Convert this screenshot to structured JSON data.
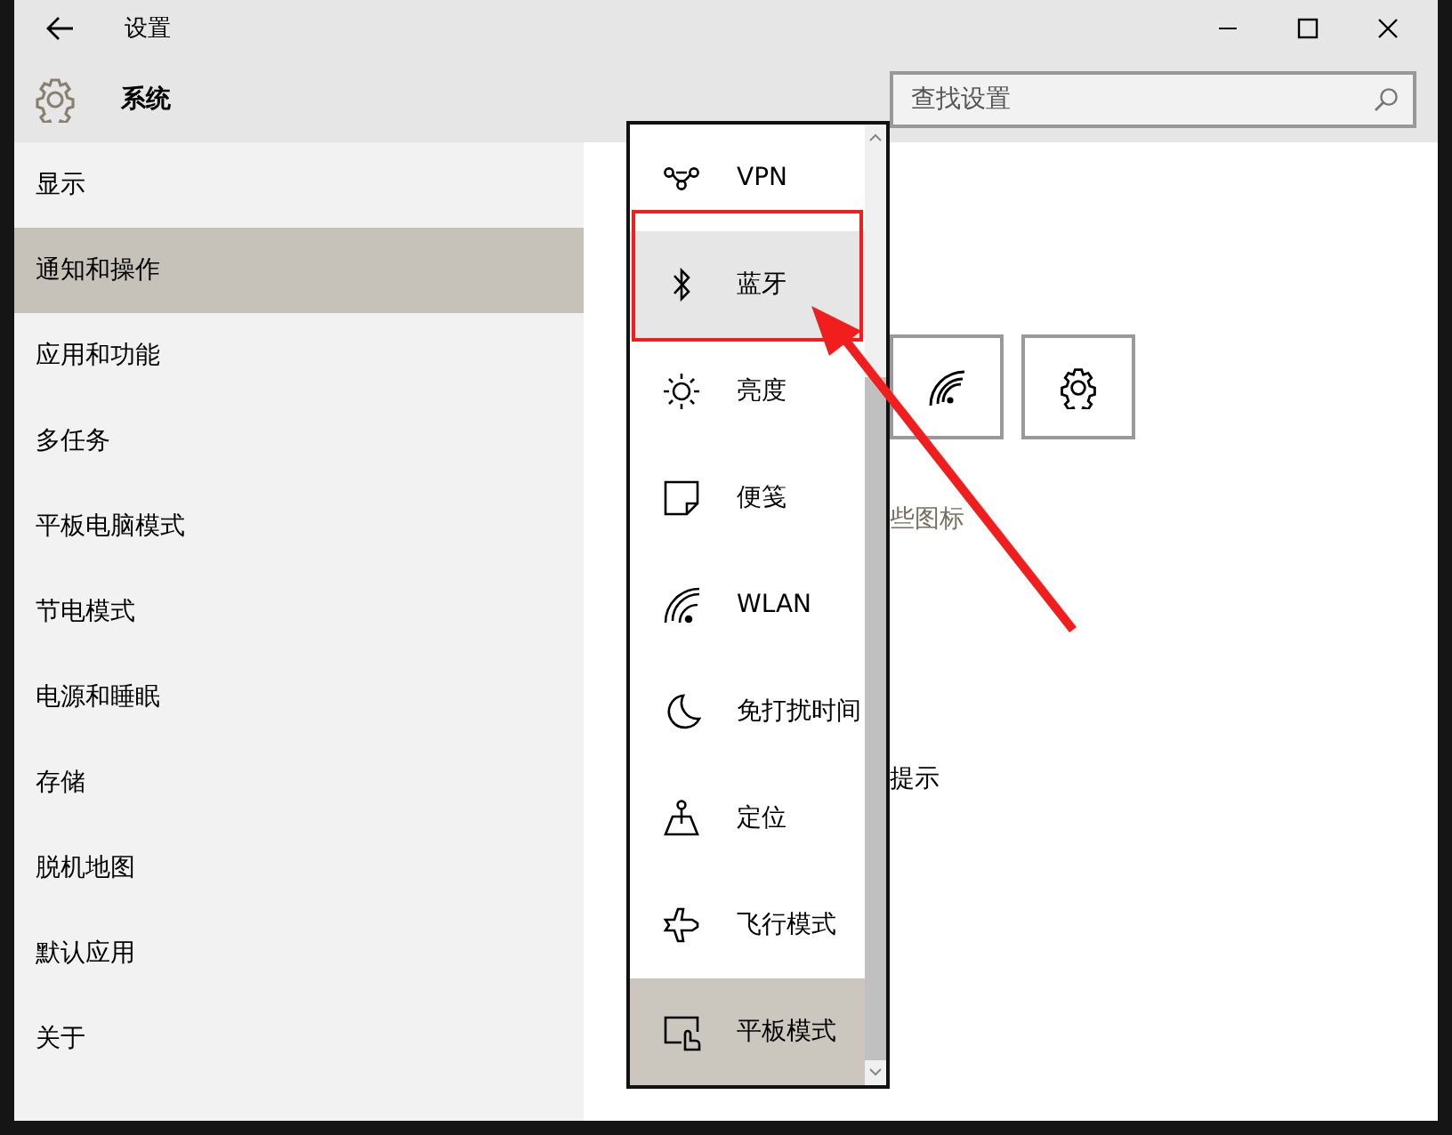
{
  "window": {
    "title": "设置"
  },
  "header": {
    "title": "系统",
    "search": {
      "placeholder": "查找设置"
    }
  },
  "sidebar": {
    "items": [
      {
        "label": "显示",
        "selected": false
      },
      {
        "label": "通知和操作",
        "selected": true
      },
      {
        "label": "应用和功能",
        "selected": false
      },
      {
        "label": "多任务",
        "selected": false
      },
      {
        "label": "平板电脑模式",
        "selected": false
      },
      {
        "label": "节电模式",
        "selected": false
      },
      {
        "label": "电源和睡眠",
        "selected": false
      },
      {
        "label": "存储",
        "selected": false
      },
      {
        "label": "脱机地图",
        "selected": false
      },
      {
        "label": "默认应用",
        "selected": false
      },
      {
        "label": "关于",
        "selected": false
      }
    ]
  },
  "main": {
    "tiles": [
      {
        "kind": "wifi"
      },
      {
        "kind": "gear"
      }
    ],
    "texts": [
      "些图标",
      "提示"
    ]
  },
  "quick_actions_menu": {
    "items": [
      {
        "kind": "vpn",
        "label": "VPN",
        "highlighted": false,
        "selected": false
      },
      {
        "kind": "bluetooth",
        "label": "蓝牙",
        "highlighted": true,
        "selected": false
      },
      {
        "kind": "brightness",
        "label": "亮度",
        "highlighted": false,
        "selected": false
      },
      {
        "kind": "note",
        "label": "便笺",
        "highlighted": false,
        "selected": false
      },
      {
        "kind": "wifi",
        "label": "WLAN",
        "highlighted": false,
        "selected": false
      },
      {
        "kind": "moon",
        "label": "免打扰时间",
        "highlighted": false,
        "selected": false
      },
      {
        "kind": "location",
        "label": "定位",
        "highlighted": false,
        "selected": false
      },
      {
        "kind": "airplane",
        "label": "飞行模式",
        "highlighted": false,
        "selected": false
      },
      {
        "kind": "tablet",
        "label": "平板模式",
        "highlighted": false,
        "selected": true
      }
    ]
  }
}
